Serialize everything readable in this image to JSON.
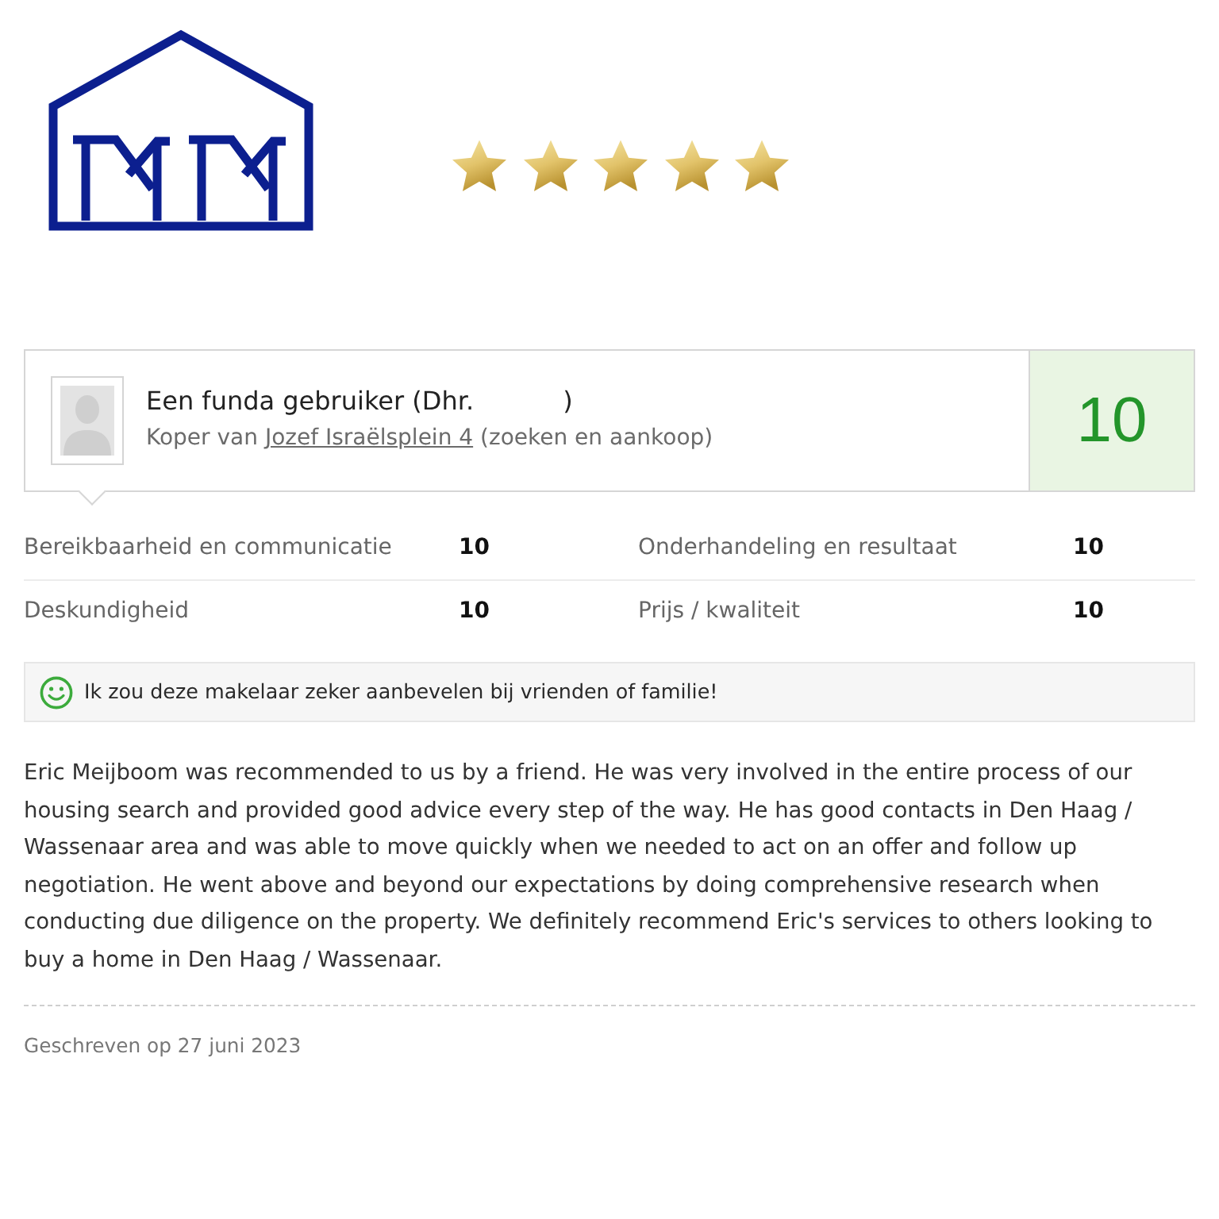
{
  "rating_stars": {
    "stars": 5
  },
  "review": {
    "reviewer": {
      "name": "Een funda gebruiker (Dhr.",
      "name_end": ")"
    },
    "buyer_info": {
      "prefix": "Koper van",
      "link": "Jozef Israëlsplein 4",
      "suffix": "(zoeken en aankoop)"
    },
    "score": "10"
  },
  "ratings": [
    {
      "label": "Bereikbaarheid en communicatie",
      "value": "10"
    },
    {
      "label": "Onderhandeling en resultaat",
      "value": "10"
    },
    {
      "label": "Deskundigheid",
      "value": "10"
    },
    {
      "label": "Prijs / kwaliteit",
      "value": "10"
    }
  ],
  "recommendation": {
    "text": "Ik zou deze makelaar zeker aanbevelen bij vrienden of familie!"
  },
  "body": "Eric Meijboom was recommended to us by a friend. He was very involved in the entire process of our housing search and provided good advice every step of the way. He has good contacts in Den Haag / Wassenaar area and was able to move quickly when we needed to act on an offer and follow up negotiation. He went above and beyond our expectations by doing comprehensive research when conducting due diligence on the property. We definitely recommend Eric's services to others looking to buy a home in Den Haag / Wassenaar.",
  "date": "Geschreven op 27 juni 2023"
}
